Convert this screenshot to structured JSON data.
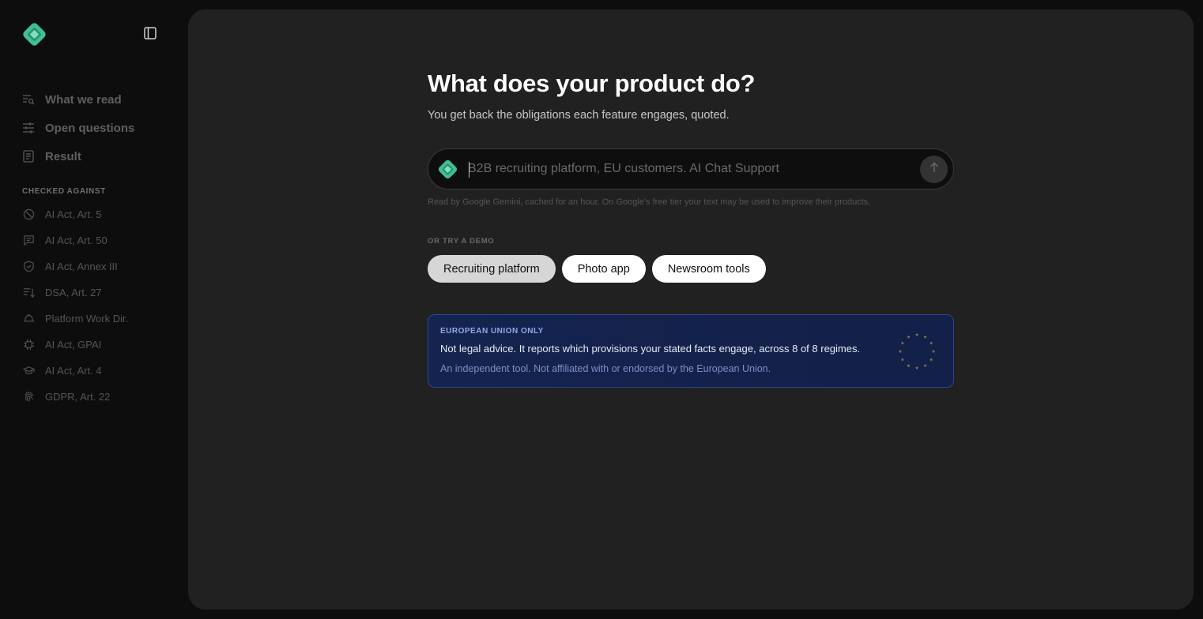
{
  "brand": {
    "logo_icon": "diamond-logo-icon",
    "accent": "#3fbf92"
  },
  "sidebar": {
    "collapse_icon": "sidebar-toggle-icon",
    "nav": [
      {
        "label": "What we read",
        "icon": "list-search-icon"
      },
      {
        "label": "Open questions",
        "icon": "sliders-icon"
      },
      {
        "label": "Result",
        "icon": "document-icon"
      }
    ],
    "section_title": "CHECKED AGAINST",
    "regimes": [
      {
        "label": "AI Act, Art. 5",
        "icon": "prohibited-icon"
      },
      {
        "label": "AI Act, Art. 50",
        "icon": "chat-bubble-icon"
      },
      {
        "label": "AI Act, Annex III",
        "icon": "shield-icon"
      },
      {
        "label": "DSA, Art. 27",
        "icon": "sort-list-icon"
      },
      {
        "label": "Platform Work Dir.",
        "icon": "worker-helmet-icon"
      },
      {
        "label": "AI Act, GPAI",
        "icon": "chip-icon"
      },
      {
        "label": "AI Act, Art. 4",
        "icon": "graduation-cap-icon"
      },
      {
        "label": "GDPR, Art. 22",
        "icon": "fingerprint-icon"
      }
    ]
  },
  "main": {
    "title": "What does your product do?",
    "subtitle": "You get back the obligations each feature engages, quoted.",
    "input": {
      "placeholder": "B2B recruiting platform, EU customers. AI Chat Support",
      "value": ""
    },
    "send_icon": "arrow-up-icon",
    "disclaimer": "Read by Google Gemini, cached for an hour. On Google's free tier your text may be used to improve their products.",
    "demo_label": "OR TRY A DEMO",
    "demos": [
      {
        "label": "Recruiting platform",
        "active": true
      },
      {
        "label": "Photo app",
        "active": false
      },
      {
        "label": "Newsroom tools",
        "active": false
      }
    ],
    "eu_notice": {
      "title": "EUROPEAN UNION ONLY",
      "text": "Not legal advice. It reports which provisions your stated facts engage, across 8 of 8 regimes.",
      "sub": "An independent tool. Not affiliated with or endorsed by the European Union.",
      "icon": "eu-stars-icon",
      "star_color": "#8a7a3a"
    }
  }
}
